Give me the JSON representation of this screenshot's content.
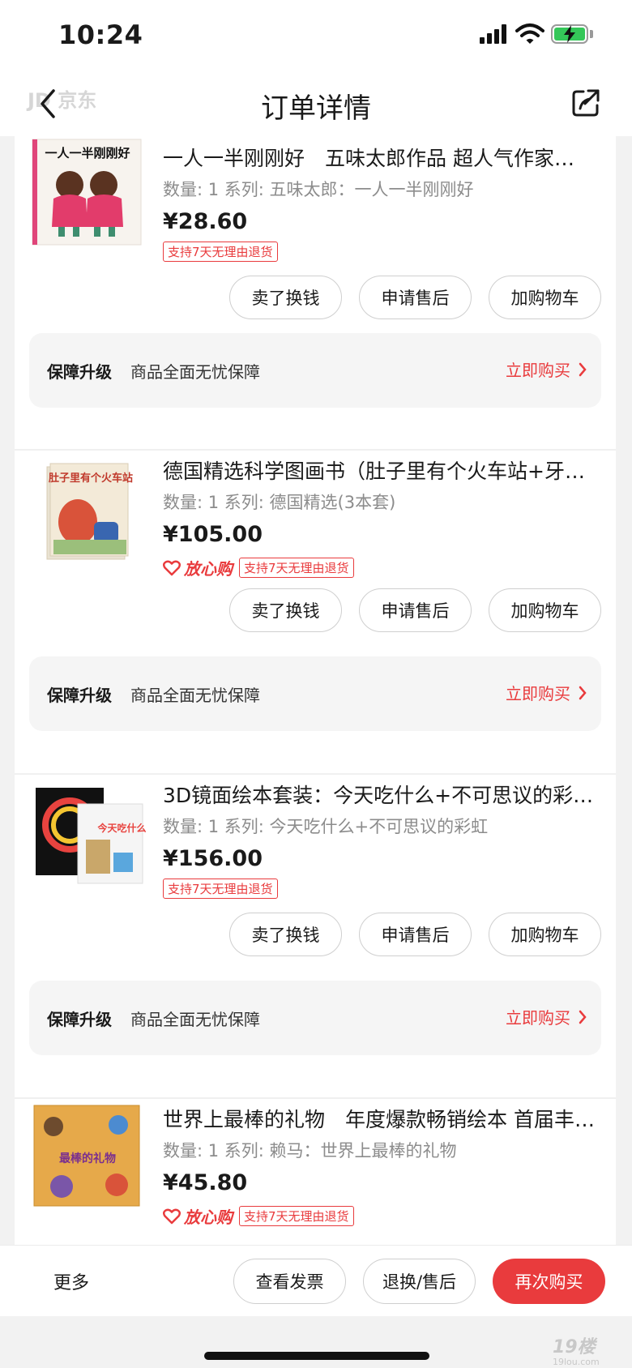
{
  "status_bar": {
    "time": "10:24"
  },
  "nav": {
    "title": "订单详情",
    "ghost_text": "JD 京东"
  },
  "items": [
    {
      "title": "一人一半刚刚好　五味太郎作品 超人气作家…",
      "spec": "数量: 1  系列: 五味太郎：一人一半刚刚好",
      "price": "¥28.60",
      "assure": "",
      "return_tag": "支持7天无理由退货",
      "cover_text": "一人一半刚刚好",
      "buttons": [
        "卖了换钱",
        "申请售后",
        "加购物车"
      ],
      "guard": {
        "title": "保障升级",
        "desc": "商品全面无忧保障",
        "cta": "立即购买"
      }
    },
    {
      "title": "德国精选科学图画书（肚子里有个火车站+牙…",
      "spec": "数量: 1  系列: 德国精选(3本套)",
      "price": "¥105.00",
      "assure": "放心购",
      "return_tag": "支持7天无理由退货",
      "cover_text": "肚子里有个火车站",
      "buttons": [
        "卖了换钱",
        "申请售后",
        "加购物车"
      ],
      "guard": {
        "title": "保障升级",
        "desc": "商品全面无忧保障",
        "cta": "立即购买"
      }
    },
    {
      "title": "3D镜面绘本套装：今天吃什么+不可思议的彩…",
      "spec": "数量: 1  系列: 今天吃什么+不可思议的彩虹",
      "price": "¥156.00",
      "assure": "",
      "return_tag": "支持7天无理由退货",
      "cover_text": "今天吃什么?",
      "buttons": [
        "卖了换钱",
        "申请售后",
        "加购物车"
      ],
      "guard": {
        "title": "保障升级",
        "desc": "商品全面无忧保障",
        "cta": "立即购买"
      }
    },
    {
      "title": "世界上最棒的礼物　年度爆款畅销绘本 首届丰…",
      "spec": "数量: 1  系列: 赖马：世界上最棒的礼物",
      "price": "¥45.80",
      "assure": "放心购",
      "return_tag": "支持7天无理由退货",
      "cover_text": "最棒的礼物",
      "buttons": [],
      "guard": null
    }
  ],
  "bottom_bar": {
    "more": "更多",
    "invoice": "查看发票",
    "aftersale": "退换/售后",
    "rebuy": "再次购买"
  },
  "watermark": {
    "main": "19楼",
    "sub": "19lou.com"
  },
  "colors": {
    "accent": "#e93b3d",
    "assure_red": "#e93b3d",
    "battery": "#34c759"
  }
}
